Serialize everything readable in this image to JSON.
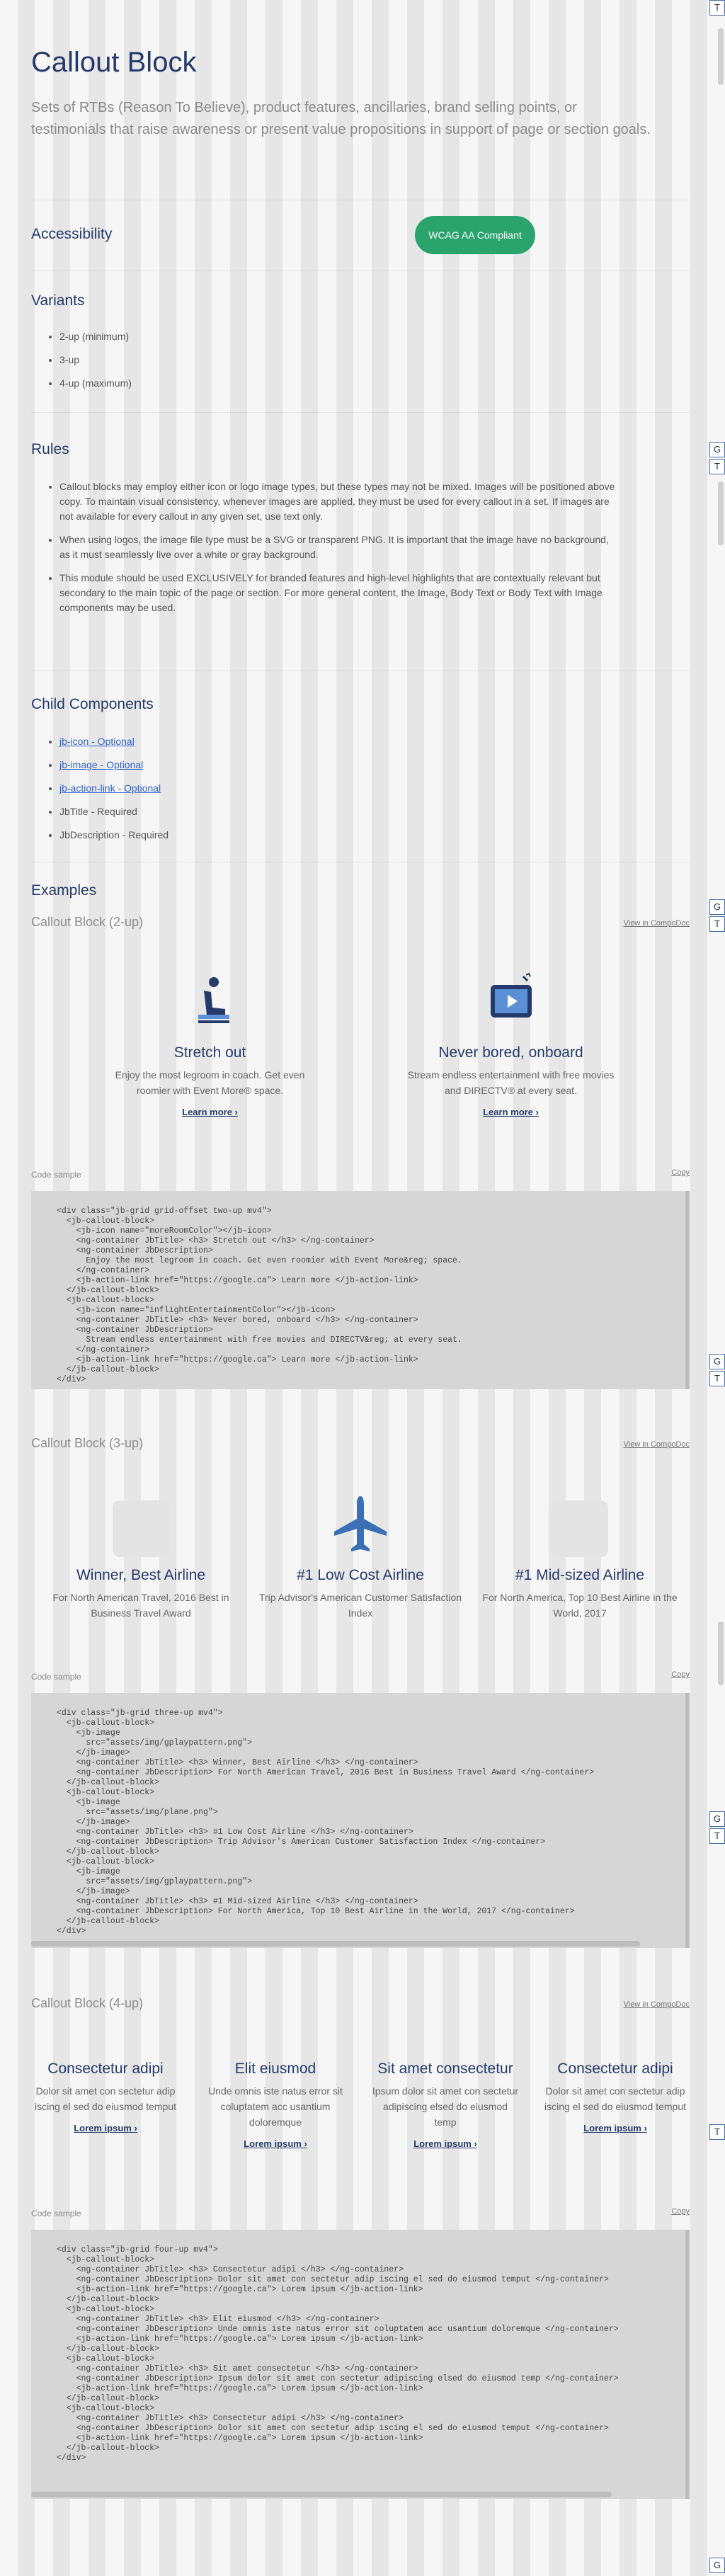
{
  "header": {
    "title": "Callout Block",
    "description": "Sets of RTBs (Reason To Believe), product features, ancillaries, brand selling points, or testimonials that raise awareness or present value propositions in support of page or section goals."
  },
  "accessibility": {
    "heading": "Accessibility",
    "badge": "WCAG AA Compliant"
  },
  "variants": {
    "heading": "Variants",
    "items": [
      "2-up (minimum)",
      "3-up",
      "4-up (maximum)"
    ]
  },
  "rules": {
    "heading": "Rules",
    "items": [
      "Callout blocks may employ either icon or logo image types, but these types may not be mixed. Images will be positioned above copy. To maintain visual consistency, whenever images are applied, they must be used for every callout in a set. If images are not available for every callout in any given set, use text only.",
      "When using logos, the image file type must be a SVG or transparent PNG. It is important that the image have no background, as it must seamlessly live over a white or gray background.",
      "This module should be used EXCLUSIVELY for branded features and high-level highlights that are contextually relevant but secondary to the main topic of the page or section. For more general content, the Image, Body Text or Body Text with Image components may be used."
    ]
  },
  "children": {
    "heading": "Child Components",
    "links": [
      "jb-icon - Optional",
      "jb-image - Optional",
      "jb-action-link - Optional"
    ],
    "items": [
      "JbTitle - Required",
      "JbDescription - Required"
    ]
  },
  "examples": {
    "heading": "Examples",
    "view_link": "View in CompoDoc",
    "code_label": "Code sample",
    "copy_link": "Copy",
    "two": {
      "title": "Callout Block (2-up)",
      "cards": [
        {
          "title": "Stretch out",
          "desc": "Enjoy the most legroom in coach. Get even roomier with Event More® space.",
          "link": "Learn more ›"
        },
        {
          "title": "Never bored, onboard",
          "desc": "Stream endless entertainment with free movies and DIRECTV® at every seat.",
          "link": "Learn more ›"
        }
      ],
      "code": "<div class=\"jb-grid grid-offset two-up mv4\">\n  <jb-callout-block>\n    <jb-icon name=\"moreRoomColor\"></jb-icon>\n    <ng-container JbTitle> <h3> Stretch out </h3> </ng-container>\n    <ng-container JbDescription>\n      Enjoy the most legroom in coach. Get even roomier with Event More&reg; space.\n    </ng-container>\n    <jb-action-link href=\"https://google.ca\"> Learn more </jb-action-link>\n  </jb-callout-block>\n  <jb-callout-block>\n    <jb-icon name=\"inflightEntertainmentColor\"></jb-icon>\n    <ng-container JbTitle> <h3> Never bored, onboard </h3> </ng-container>\n    <ng-container JbDescription>\n      Stream endless entertainment with free movies and DIRECTV&reg; at every seat.\n    </ng-container>\n    <jb-action-link href=\"https://google.ca\"> Learn more </jb-action-link>\n  </jb-callout-block>\n</div>"
    },
    "three": {
      "title": "Callout Block (3-up)",
      "cards": [
        {
          "title": "Winner, Best Airline",
          "desc": "For North American Travel, 2016 Best in Business Travel Award"
        },
        {
          "title": "#1 Low Cost Airline",
          "desc": "Trip Advisor's American Customer Satisfaction Index"
        },
        {
          "title": "#1 Mid-sized Airline",
          "desc": "For North America, Top 10 Best Airline in the World, 2017"
        }
      ],
      "code": "<div class=\"jb-grid three-up mv4\">\n  <jb-callout-block>\n    <jb-image\n      src=\"assets/img/gplaypattern.png\">\n    </jb-image>\n    <ng-container JbTitle> <h3> Winner, Best Airline </h3> </ng-container>\n    <ng-container JbDescription> For North American Travel, 2016 Best in Business Travel Award </ng-container>\n  </jb-callout-block>\n  <jb-callout-block>\n    <jb-image\n      src=\"assets/img/plane.png\">\n    </jb-image>\n    <ng-container JbTitle> <h3> #1 Low Cost Airline </h3> </ng-container>\n    <ng-container JbDescription> Trip Advisor's American Customer Satisfaction Index </ng-container>\n  </jb-callout-block>\n  <jb-callout-block>\n    <jb-image\n      src=\"assets/img/gplaypattern.png\">\n    </jb-image>\n    <ng-container JbTitle> <h3> #1 Mid-sized Airline </h3> </ng-container>\n    <ng-container JbDescription> For North America, Top 10 Best Airline in the World, 2017 </ng-container>\n  </jb-callout-block>\n</div>"
    },
    "four": {
      "title": "Callout Block (4-up)",
      "cards": [
        {
          "title": "Consectetur adipi",
          "desc": "Dolor sit amet con sectetur adip iscing el sed do eiusmod temput",
          "link": "Lorem ipsum ›"
        },
        {
          "title": "Elit eiusmod",
          "desc": "Unde omnis iste natus error sit coluptatem acc usantium doloremque",
          "link": "Lorem ipsum ›"
        },
        {
          "title": "Sit amet consectetur",
          "desc": "Ipsum dolor sit amet con sectetur adipiscing elsed do eiusmod temp",
          "link": "Lorem ipsum ›"
        },
        {
          "title": "Consectetur adipi",
          "desc": "Dolor sit amet con sectetur adip iscing el sed do eiusmod temput",
          "link": "Lorem ipsum ›"
        }
      ],
      "code": "<div class=\"jb-grid four-up mv4\">\n  <jb-callout-block>\n    <ng-container JbTitle> <h3> Consectetur adipi </h3> </ng-container>\n    <ng-container JbDescription> Dolor sit amet con sectetur adip iscing el sed do eiusmod temput </ng-container>\n    <jb-action-link href=\"https://google.ca\"> Lorem ipsum </jb-action-link>\n  </jb-callout-block>\n  <jb-callout-block>\n    <ng-container JbTitle> <h3> Elit eiusmod </h3> </ng-container>\n    <ng-container JbDescription> Unde omnis iste natus error sit coluptatem acc usantium doloremque </ng-container>\n    <jb-action-link href=\"https://google.ca\"> Lorem ipsum </jb-action-link>\n  </jb-callout-block>\n  <jb-callout-block>\n    <ng-container JbTitle> <h3> Sit amet consectetur </h3> </ng-container>\n    <ng-container JbDescription> Ipsum dolor sit amet con sectetur adipiscing elsed do eiusmod temp </ng-container>\n    <jb-action-link href=\"https://google.ca\"> Lorem ipsum </jb-action-link>\n  </jb-callout-block>\n  <jb-callout-block>\n    <ng-container JbTitle> <h3> Consectetur adipi </h3> </ng-container>\n    <ng-container JbDescription> Dolor sit amet con sectetur adip iscing el sed do eiusmod temput </ng-container>\n    <jb-action-link href=\"https://google.ca\"> Lorem ipsum </jb-action-link>\n  </jb-callout-block>\n</div>"
    }
  },
  "side": {
    "g": "G",
    "t": "T"
  }
}
